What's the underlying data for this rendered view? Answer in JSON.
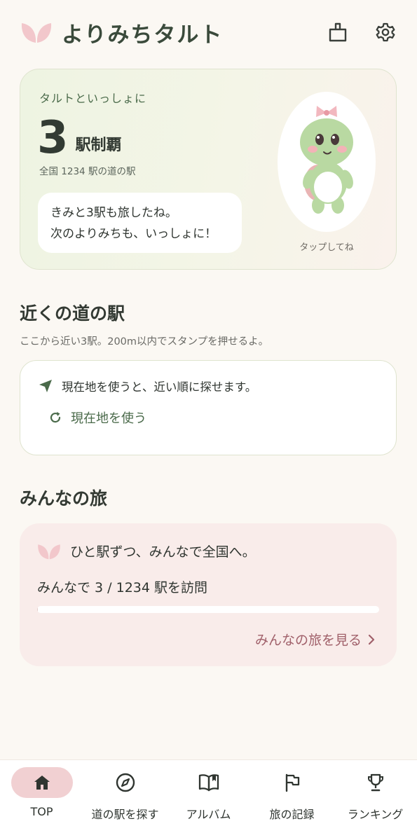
{
  "app": {
    "title": "よりみちタルト"
  },
  "header": {
    "icons": [
      "share-icon",
      "gear-icon"
    ]
  },
  "hero": {
    "eyebrow": "タルトといっしょに",
    "count": "3",
    "count_unit": "駅制覇",
    "sub": "全国 1234 駅の道の駅",
    "bubble_line1": "きみと3駅も旅したね。",
    "bubble_line2": "次のよりみちも、いっしょに！",
    "mascot_hint": "タップしてね"
  },
  "nearby": {
    "title": "近くの道の駅",
    "desc": "ここから近い3駅。200m以内でスタンプを押せるよ。",
    "hint": "現在地を使うと、近い順に探せます。",
    "use_location": "現在地を使う"
  },
  "everyone": {
    "title": "みんなの旅",
    "headline": "ひと駅ずつ、みんなで全国へ。",
    "progress_text": "みんなで 3 / 1234 駅を訪問",
    "progress_fraction": 0.0024,
    "link": "みんなの旅を見る"
  },
  "nav": {
    "items": [
      {
        "label": "TOP",
        "icon": "home-icon",
        "active": true
      },
      {
        "label": "道の駅を探す",
        "icon": "compass-icon",
        "active": false
      },
      {
        "label": "アルバム",
        "icon": "book-icon",
        "active": false
      },
      {
        "label": "旅の記録",
        "icon": "flag-icon",
        "active": false
      },
      {
        "label": "ランキング",
        "icon": "trophy-icon",
        "active": false
      }
    ]
  },
  "colors": {
    "background": "#fbf8f3",
    "accent_green": "#4a6a4a",
    "accent_pink": "#a0606a",
    "nav_active": "#f1d0d2"
  }
}
